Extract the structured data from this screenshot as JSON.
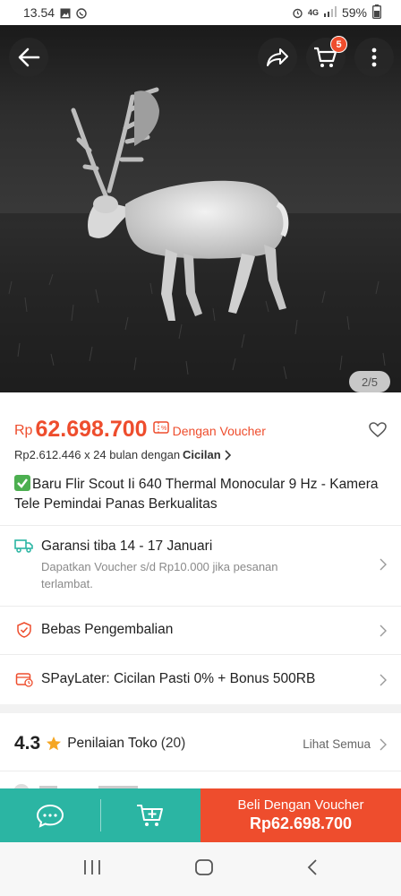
{
  "status_bar": {
    "time": "13.54",
    "network": "4G",
    "battery": "59%"
  },
  "header": {
    "cart_count": "5",
    "image_pager": "2/5"
  },
  "colors": {
    "brand": "#ee4d2d",
    "teal": "#2bb5a3"
  },
  "product": {
    "currency": "Rp",
    "price": "62.698.700",
    "voucher_label": "Dengan Voucher",
    "installment_text": "Rp2.612.446 x 24 bulan dengan",
    "installment_brand": "Cicilan",
    "title": "Baru Flir Scout Ii 640 Thermal Monocular 9 Hz - Kamera Tele Pemindai Panas Berkualitas"
  },
  "shipping": {
    "guarantee": "Garansi tiba 14 - 17 Januari",
    "guarantee_note": "Dapatkan Voucher s/d Rp10.000 jika pesanan terlambat."
  },
  "returns": {
    "label": "Bebas Pengembalian"
  },
  "paylater": {
    "label": "SPayLater: Cicilan Pasti 0% + Bonus 500RB"
  },
  "shop_rating": {
    "value": "4.3",
    "label": "Penilaian Toko",
    "count": "(20)",
    "see_all": "Lihat Semua"
  },
  "actions": {
    "buy_label": "Beli Dengan Voucher",
    "buy_price": "Rp62.698.700"
  },
  "icons": [
    "back-arrow-icon",
    "share-icon",
    "cart-icon",
    "more-icon",
    "heart-icon",
    "truck-icon",
    "shield-icon",
    "paylater-icon",
    "star-icon",
    "chat-icon",
    "add-to-cart-icon"
  ]
}
